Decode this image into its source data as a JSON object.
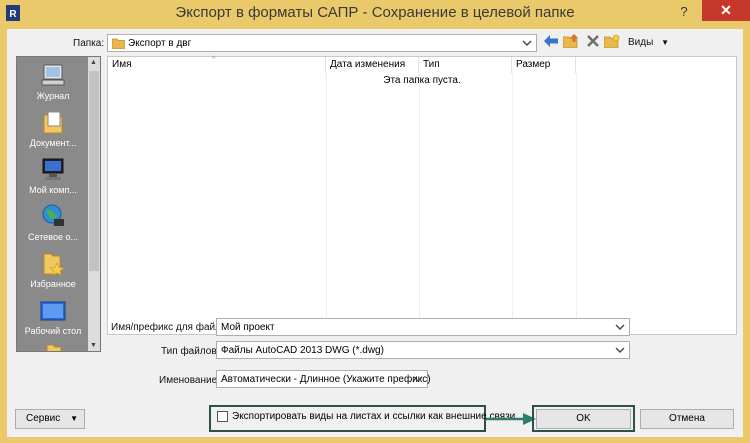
{
  "window": {
    "title": "Экспорт в форматы САПР - Сохранение в целевой папке",
    "help": "?",
    "close": "✕"
  },
  "toolbar": {
    "folder_label": "Папка:",
    "folder_value": "Экспорт в двг",
    "views_label": "Виды"
  },
  "sidebar": {
    "items": [
      {
        "label": "Журнал",
        "icon": "history-icon"
      },
      {
        "label": "Документ...",
        "icon": "documents-folder-icon"
      },
      {
        "label": "Мой комп...",
        "icon": "my-computer-icon"
      },
      {
        "label": "Сетевое о...",
        "icon": "network-icon"
      },
      {
        "label": "Избранное",
        "icon": "favorites-folder-icon"
      },
      {
        "label": "Рабочий стол",
        "icon": "desktop-icon"
      }
    ]
  },
  "filelist": {
    "columns": [
      "Имя",
      "Дата изменения",
      "Тип",
      "Размер"
    ],
    "empty_message": "Эта папка пуста."
  },
  "form": {
    "filename_label": "Имя/префикс для файла:",
    "filename_value": "Мой проект",
    "filetype_label": "Тип файлов:",
    "filetype_value": "Файлы AutoCAD 2013 DWG  (*.dwg)",
    "naming_label": "Именование:",
    "naming_value": "Автоматически - Длинное (Укажите префикс)"
  },
  "footer": {
    "tools_label": "Сервис",
    "export_checkbox_label": "Экспортировать виды на листах и ссылки как внешние связи",
    "export_checkbox_checked": false,
    "ok_label": "OK",
    "cancel_label": "Отмена"
  },
  "colors": {
    "title_bar": "#eac96a",
    "close_button": "#c7382c",
    "highlight_frame": "#2f4f4a",
    "arrow": "#2e7d6b"
  }
}
